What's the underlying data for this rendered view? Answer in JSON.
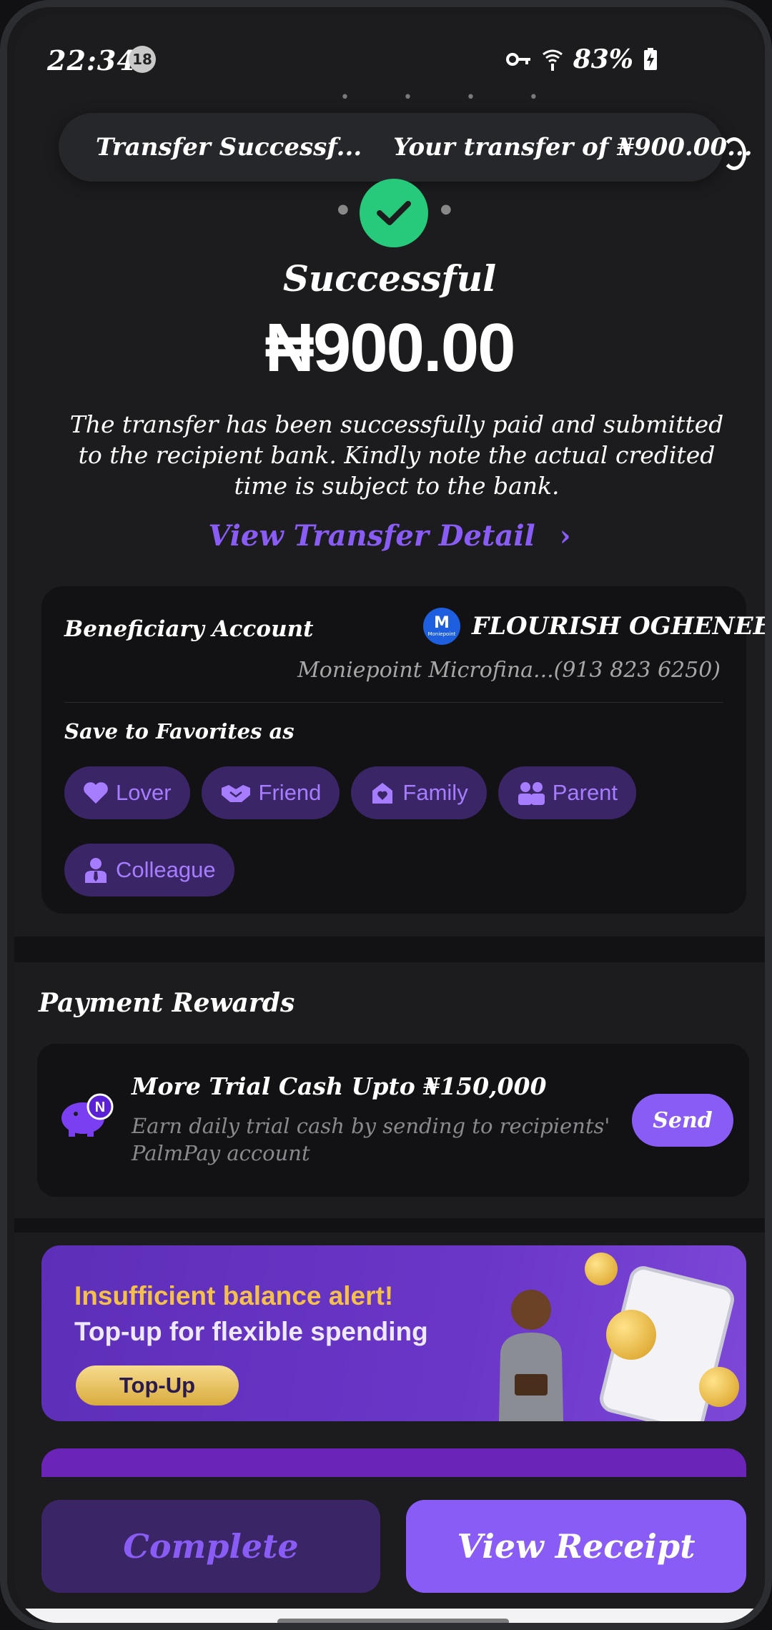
{
  "status_bar": {
    "time": "22:34",
    "notification_count": "18",
    "battery": "83%"
  },
  "toast": {
    "title": "Transfer Successf...",
    "message": "Your transfer of ₦900.00..."
  },
  "result": {
    "status": "Successful",
    "amount": "₦900.00",
    "description": "The transfer has been successfully paid and submitted to the recipient bank. Kindly note the actual credited time is subject to the bank.",
    "view_detail": "View Transfer Detail"
  },
  "beneficiary": {
    "label": "Beneficiary Account",
    "logo_letter": "M",
    "logo_text": "Moniepoint",
    "name": "FLOURISH OGHENEE...",
    "bank": "Moniepoint Microfina...(913 823 6250)"
  },
  "favorites": {
    "label": "Save to Favorites as",
    "chips": [
      {
        "label": "Lover",
        "icon": "heart-icon"
      },
      {
        "label": "Friend",
        "icon": "handshake-icon"
      },
      {
        "label": "Family",
        "icon": "home-heart-icon"
      },
      {
        "label": "Parent",
        "icon": "people-icon"
      },
      {
        "label": "Colleague",
        "icon": "person-tie-icon"
      }
    ]
  },
  "rewards": {
    "section_title": "Payment Rewards",
    "title": "More Trial Cash Upto ₦150,000",
    "subtitle": "Earn daily trial cash by sending to recipients' PalmPay account",
    "button": "Send",
    "badge_letter": "N"
  },
  "banner": {
    "headline": "Insufficient balance alert!",
    "subline": "Top-up for flexible spending",
    "button": "Top-Up"
  },
  "actions": {
    "complete": "Complete",
    "view_receipt": "View Receipt"
  },
  "colors": {
    "accent": "#8a5cf6",
    "chip_bg": "#3a2566",
    "success": "#27c97a"
  }
}
